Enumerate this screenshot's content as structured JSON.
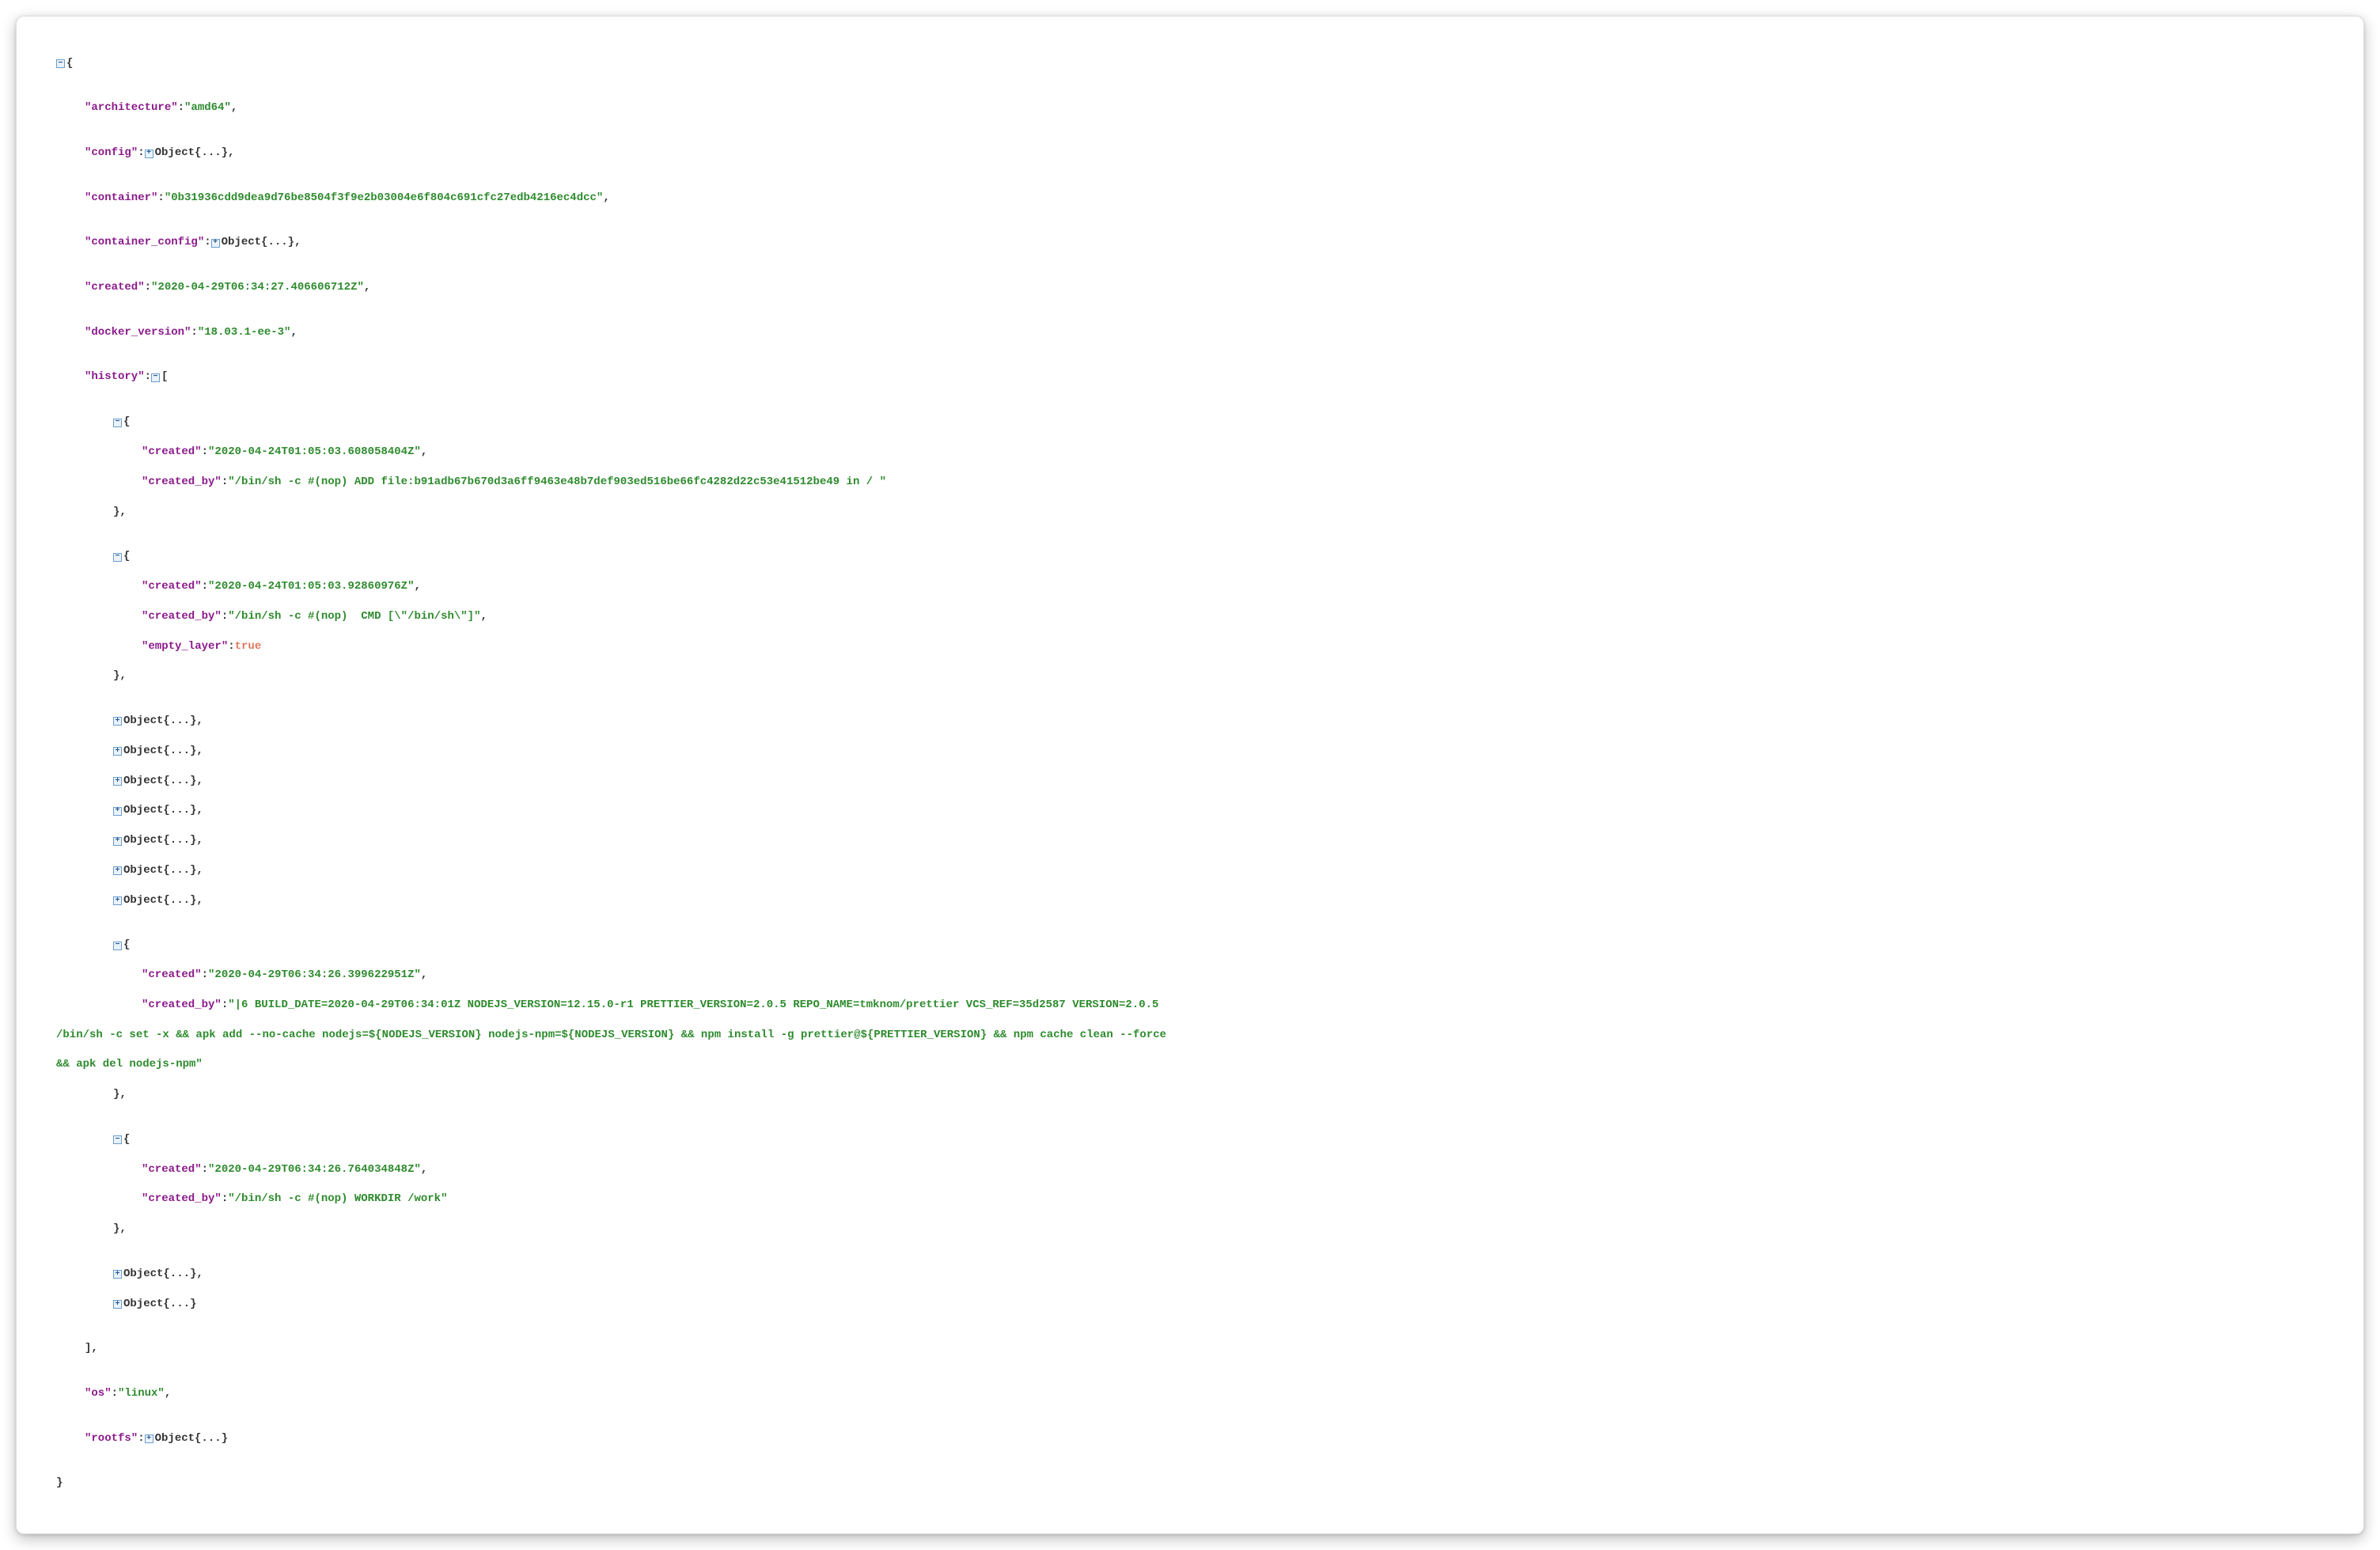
{
  "collapsed_placeholder": "Object{...}",
  "root_open": "{",
  "root_close": "}",
  "fields": {
    "architecture": {
      "key": "\"architecture\"",
      "value": "\"amd64\""
    },
    "config": {
      "key": "\"config\""
    },
    "container": {
      "key": "\"container\"",
      "value": "\"0b31936cdd9dea9d76be8504f3f9e2b03004e6f804c691cfc27edb4216ec4dcc\""
    },
    "container_config": {
      "key": "\"container_config\""
    },
    "created": {
      "key": "\"created\"",
      "value": "\"2020-04-29T06:34:27.406606712Z\""
    },
    "docker_version": {
      "key": "\"docker_version\"",
      "value": "\"18.03.1-ee-3\""
    },
    "history": {
      "key": "\"history\"",
      "open": "[",
      "close": "],"
    },
    "os": {
      "key": "\"os\"",
      "value": "\"linux\""
    },
    "rootfs": {
      "key": "\"rootfs\""
    }
  },
  "history_items": {
    "open_obj": "{",
    "close_obj": "},",
    "close_obj_last": "}",
    "item0": {
      "created_key": "\"created\"",
      "created_val": "\"2020-04-24T01:05:03.608058404Z\"",
      "created_by_key": "\"created_by\"",
      "created_by_val": "\"/bin/sh -c #(nop) ADD file:b91adb67b670d3a6ff9463e48b7def903ed516be66fc4282d22c53e41512be49 in / \""
    },
    "item1": {
      "created_key": "\"created\"",
      "created_val": "\"2020-04-24T01:05:03.92860976Z\"",
      "created_by_key": "\"created_by\"",
      "created_by_val": "\"/bin/sh -c #(nop)  CMD [\\\"/bin/sh\\\"]\"",
      "empty_layer_key": "\"empty_layer\"",
      "empty_layer_val": "true"
    },
    "itemBig": {
      "created_key": "\"created\"",
      "created_val": "\"2020-04-29T06:34:26.399622951Z\"",
      "created_by_key": "\"created_by\"",
      "created_by_val_l1": "\"|6 BUILD_DATE=2020-04-29T06:34:01Z NODEJS_VERSION=12.15.0-r1 PRETTIER_VERSION=2.0.5 REPO_NAME=tmknom/prettier VCS_REF=35d2587 VERSION=2.0.5",
      "created_by_val_l2": "/bin/sh -c set -x && apk add --no-cache nodejs=${NODEJS_VERSION} nodejs-npm=${NODEJS_VERSION} && npm install -g prettier@${PRETTIER_VERSION} && npm cache clean --force",
      "created_by_val_l3": "&& apk del nodejs-npm\""
    },
    "itemWork": {
      "created_key": "\"created\"",
      "created_val": "\"2020-04-29T06:34:26.764034848Z\"",
      "created_by_key": "\"created_by\"",
      "created_by_val": "\"/bin/sh -c #(nop) WORKDIR /work\""
    }
  }
}
